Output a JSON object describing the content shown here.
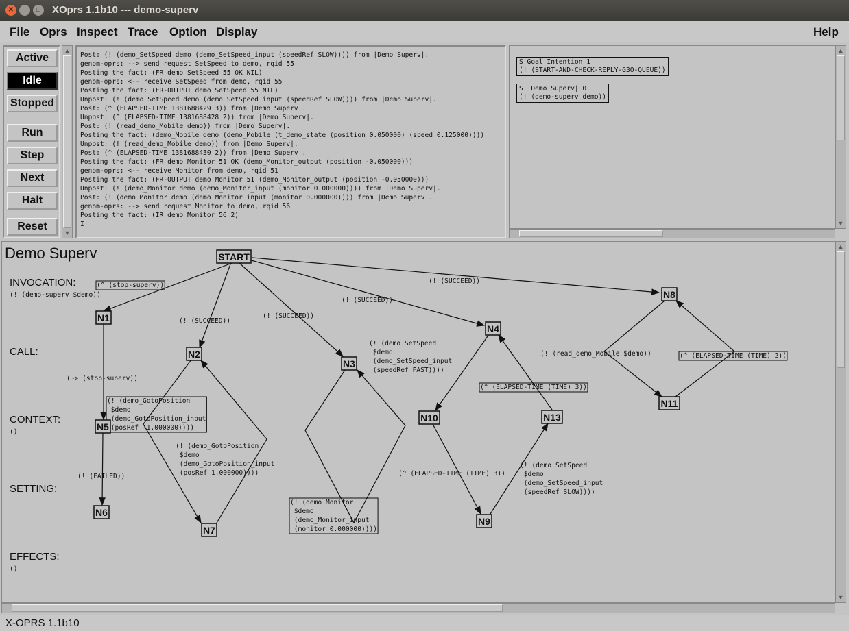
{
  "window": {
    "title": "XOprs 1.1b10 --- demo-superv"
  },
  "menu": {
    "items": [
      "File",
      "Oprs",
      "Inspect",
      "Trace",
      "Option",
      "Display"
    ],
    "help": "Help"
  },
  "controls": {
    "active": "Active",
    "idle": "Idle",
    "stopped": "Stopped",
    "run": "Run",
    "step": "Step",
    "next": "Next",
    "halt": "Halt",
    "reset": "Reset",
    "selected": "Idle"
  },
  "log": {
    "lines": [
      "Post: (! (demo_SetSpeed demo (demo_SetSpeed_input (speedRef SLOW)))) from |Demo Superv|.",
      "genom-oprs: --> send request SetSpeed to demo, rqid 55",
      "Posting the fact: (FR demo SetSpeed 55 OK NIL)",
      "genom-oprs: <-- receive SetSpeed from demo, rqid 55",
      "Posting the fact: (FR-OUTPUT demo SetSpeed 55 NIL)",
      "Unpost: (! (demo_SetSpeed demo (demo_SetSpeed_input (speedRef SLOW)))) from |Demo Superv|.",
      "Post: (^ (ELAPSED-TIME 1381688429 3)) from |Demo Superv|.",
      "Unpost: (^ (ELAPSED-TIME 1381688428 2)) from |Demo Superv|.",
      "Post: (! (read_demo_Mobile demo)) from |Demo Superv|.",
      "Posting the fact: (demo_Mobile demo (demo_Mobile (t_demo_state (position 0.050000) (speed 0.125000))))",
      "Unpost: (! (read_demo_Mobile demo)) from |Demo Superv|.",
      "Post: (^ (ELAPSED-TIME 1381688430 2)) from |Demo Superv|.",
      "Posting the fact: (FR demo Monitor 51 OK (demo_Monitor_output (position -0.050000)))",
      "genom-oprs: <-- receive Monitor from demo, rqid 51",
      "Posting the fact: (FR-OUTPUT demo Monitor 51 (demo_Monitor_output (position -0.050000)))",
      "Unpost: (! (demo_Monitor demo (demo_Monitor_input (monitor 0.000000)))) from |Demo Superv|.",
      "Post: (! (demo_Monitor demo (demo_Monitor_input (monitor 0.000000)))) from |Demo Superv|.",
      "genom-oprs: --> send request Monitor to demo, rqid 56",
      "Posting the fact: (IR demo Monitor 56 2)"
    ]
  },
  "intentions": [
    {
      "text": "S Goal Intention 1\n(! (START-AND-CHECK-REPLY-G3O-QUEUE))"
    },
    {
      "text": "S |Demo Superv| 0\n(! (demo-superv demo))"
    }
  ],
  "op": {
    "name": "Demo Superv",
    "invocation_label": "INVOCATION:",
    "invocation": "(! (demo-superv $demo))",
    "call_label": "CALL:",
    "context_label": "CONTEXT:",
    "context": "()",
    "setting_label": "SETTING:",
    "effects_label": "EFFECTS:",
    "effects": "()"
  },
  "nodes": [
    "START",
    "N1",
    "N2",
    "N3",
    "N4",
    "N5",
    "N6",
    "N7",
    "N8",
    "N9",
    "N10",
    "N11",
    "N13"
  ],
  "edges": [
    {
      "from": "START",
      "to": "N1",
      "label": "(^ (stop-superv))"
    },
    {
      "from": "START",
      "to": "N2",
      "label": "(! (SUCCEED))"
    },
    {
      "from": "START",
      "to": "N3",
      "label": "(! (SUCCEED))"
    },
    {
      "from": "START",
      "to": "N4",
      "label": "(! (SUCCEED))"
    },
    {
      "from": "START",
      "to": "N8",
      "label": "(! (SUCCEED))"
    },
    {
      "from": "N1",
      "to": "N5",
      "label": "(~> (stop-superv))"
    },
    {
      "from": "N5",
      "to": "N6",
      "label": "(! (FAILED))"
    },
    {
      "from": "N2",
      "to": "N7",
      "label": "(! (demo_GotoPosition\n      $demo\n      (demo_GotoPosition_input\n          (posRef -1.000000))))"
    },
    {
      "from": "N7",
      "to": "N2",
      "label": "(! (demo_GotoPosition\n      $demo\n      (demo_GotoPosition_input\n          (posRef 1.000000))))"
    },
    {
      "from": "N3",
      "to": "N3",
      "label": "(! (demo_Monitor\n      $demo\n      (demo_Monitor_input\n          (monitor 0.000000))))"
    },
    {
      "from": "N4",
      "to": "N10",
      "label": "(! (demo_SetSpeed\n      $demo\n      (demo_SetSpeed_input\n          (speedRef FAST))))"
    },
    {
      "from": "N10",
      "to": "N9",
      "label": "(^ (ELAPSED-TIME (TIME) 3))"
    },
    {
      "from": "N9",
      "to": "N13",
      "label": "(! (demo_SetSpeed\n      $demo\n      (demo_SetSpeed_input\n          (speedRef SLOW))))"
    },
    {
      "from": "N13",
      "to": "N4",
      "label": "(^ (ELAPSED-TIME (TIME) 3))"
    },
    {
      "from": "N8",
      "to": "N11",
      "label": "(! (read_demo_Mobile $demo))"
    },
    {
      "from": "N11",
      "to": "N8",
      "label": "(^ (ELAPSED-TIME (TIME) 2))"
    }
  ],
  "status": {
    "text": "X-OPRS 1.1b10"
  }
}
